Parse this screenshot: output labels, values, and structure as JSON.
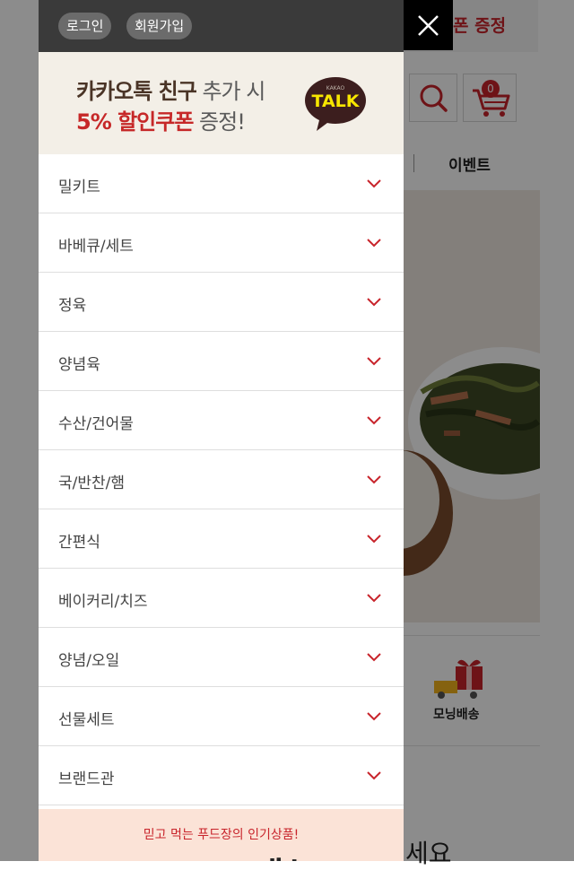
{
  "header": {
    "login_label": "로그인",
    "signup_label": "회원가입"
  },
  "kakao_banner": {
    "line1_strong": "카카오톡 친구",
    "line1_light": " 추가 시",
    "line2_red": "5% 할인쿠폰",
    "line2_light": " 증정!",
    "bubble_small": "KAKAO",
    "bubble_text": "TALK"
  },
  "menu": {
    "items": [
      {
        "label": "밀키트"
      },
      {
        "label": "바베큐/세트"
      },
      {
        "label": "정육"
      },
      {
        "label": "양념육"
      },
      {
        "label": "수산/건어물"
      },
      {
        "label": "국/반찬/햄"
      },
      {
        "label": "간편식"
      },
      {
        "label": "베이커리/치즈"
      },
      {
        "label": "양념/오일"
      },
      {
        "label": "선물세트"
      },
      {
        "label": "브랜드관"
      }
    ]
  },
  "best_banner": {
    "subtitle": "믿고 먹는 푸드장의 인기상품!",
    "title": "BEST 메뉴"
  },
  "background": {
    "coupon_text": "폰 증정",
    "cart_count": "0",
    "event_label": "이벤트",
    "morning_label": "모닝배송",
    "bottom_text": "세요"
  },
  "colors": {
    "accent": "#c8242b",
    "header_bg": "#3a3a3a",
    "kakao_yellow": "#f7e600",
    "kakao_brown": "#3c1e1e"
  },
  "icons": {
    "close": "close-icon",
    "chevron": "chevron-down-icon",
    "search": "search-icon",
    "cart": "cart-icon"
  }
}
